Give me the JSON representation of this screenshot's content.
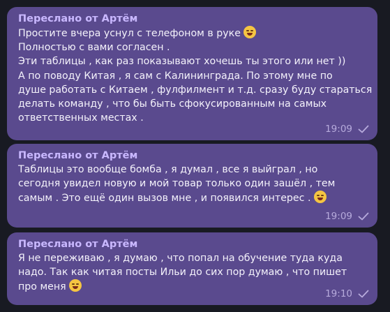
{
  "messages": [
    {
      "forwarded_label": "Переслано от Артём",
      "lines": [
        "Простите вчера уснул с телефоном в руке",
        "Полностью с вами согласен .",
        "Эти таблицы , как раз показывают хочешь ты этого или нет ))",
        "А по поводу Китая , я сам с Калининграда. По этому мне по",
        "душе работать с Китаем , фулфилмент и т.д. сразу буду стараться",
        "делать команду , что бы быть сфокусированным на самых",
        "ответственных местах ."
      ],
      "emoji": "laughing-crying-emoji",
      "time": "19:09"
    },
    {
      "forwarded_label": "Переслано от Артём",
      "lines": [
        "Таблицы это вообще бомба , я думал , все я выйграл , но",
        "сегодня увидел новую и мой товар только один зашёл , тем",
        "самым . Это ещё один вызов мне , и появился интерес ."
      ],
      "emoji": "grinning-emoji",
      "time": "19:09"
    },
    {
      "forwarded_label": "Переслано от Артём",
      "lines": [
        "Я не переживаю , я думаю , что попал на обучение туда куда",
        "надо.  Так как читая посты Ильи до сих пор думаю , что пишет",
        "про меня"
      ],
      "emoji": "laughing-crying-emoji",
      "time": "19:10"
    }
  ],
  "colors": {
    "background": "#181a22",
    "bubble": "#5a4a8e",
    "forwarded_name": "#c9b8ff",
    "meta": "#b7abdc"
  },
  "icons": [
    "check-icon"
  ]
}
